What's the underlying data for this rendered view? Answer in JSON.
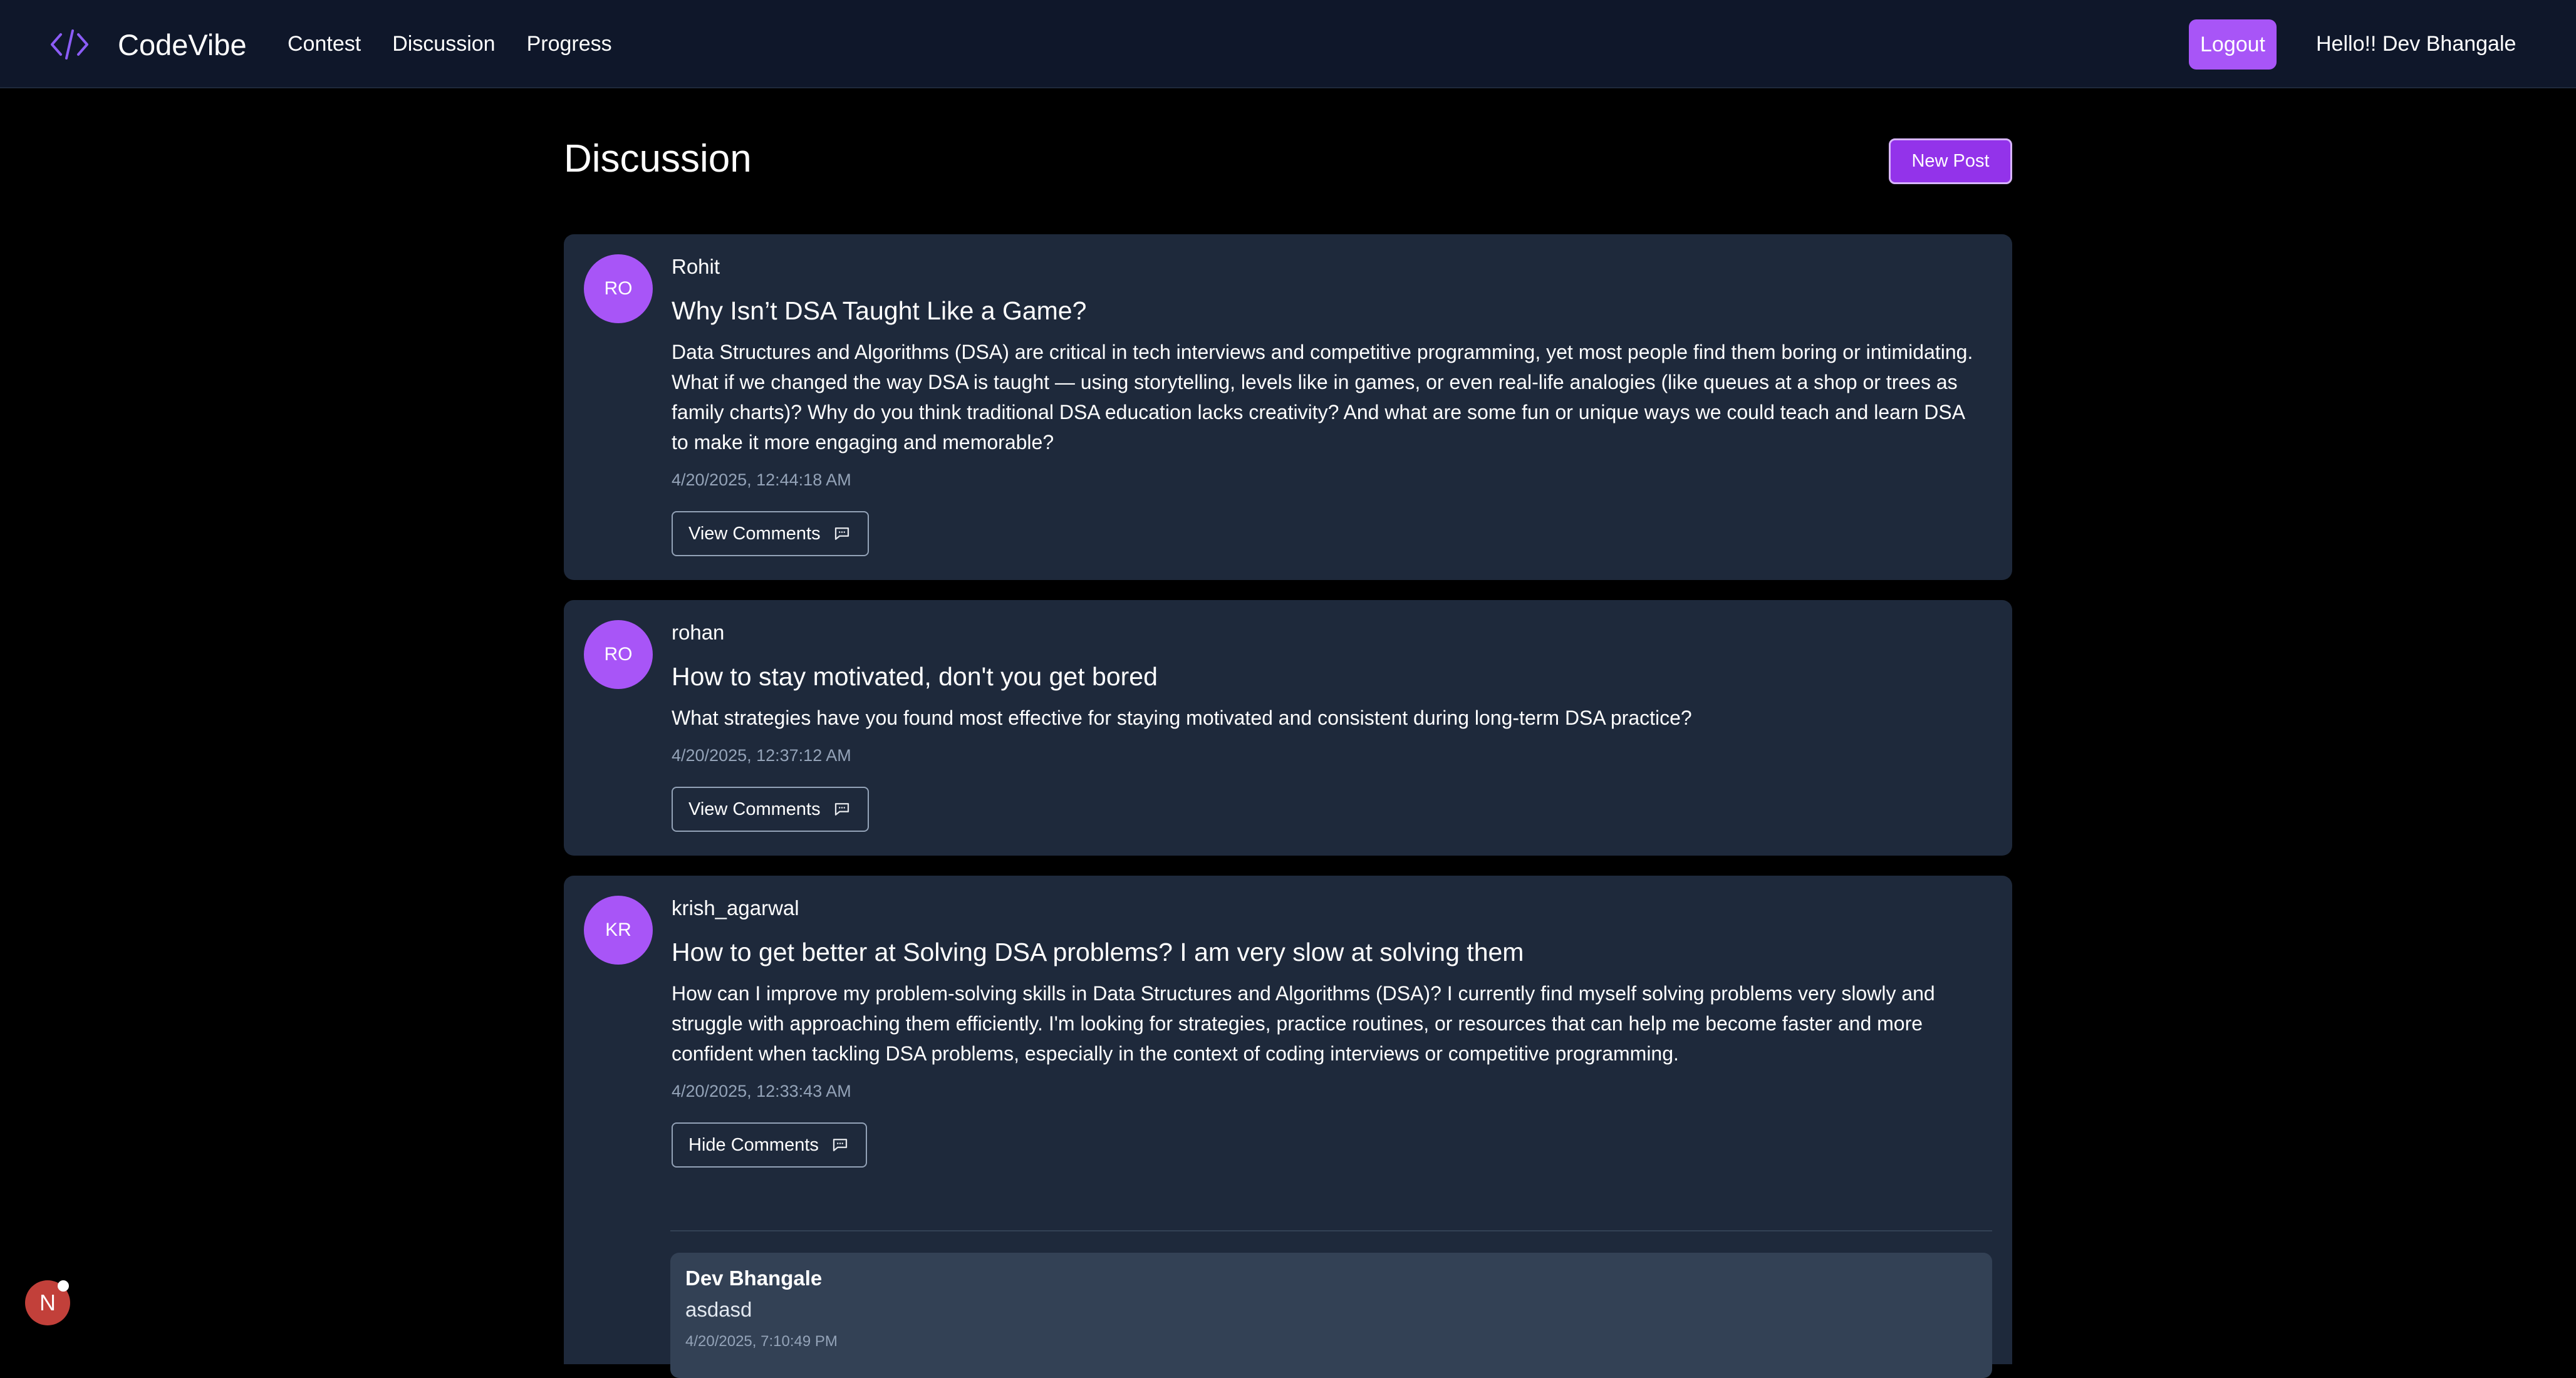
{
  "nav": {
    "brand": "CodeVibe",
    "brand_icon": "code-icon",
    "links": [
      "Contest",
      "Discussion",
      "Progress"
    ],
    "logout_label": "Logout",
    "greeting": "Hello!! Dev Bhangale"
  },
  "page": {
    "title": "Discussion",
    "new_post_label": "New Post"
  },
  "posts": [
    {
      "initials": "RO",
      "author": "Rohit",
      "title": "Why Isn’t DSA Taught Like a Game?",
      "body": "Data Structures and Algorithms (DSA) are critical in tech interviews and competitive programming, yet most people find them boring or intimidating. What if we changed the way DSA is taught — using storytelling, levels like in games, or even real-life analogies (like queues at a shop or trees as family charts)? Why do you think traditional DSA education lacks creativity? And what are some fun or unique ways we could teach and learn DSA to make it more engaging and memorable?",
      "time": "4/20/2025, 12:44:18 AM",
      "comments_label": "View Comments"
    },
    {
      "initials": "RO",
      "author": "rohan",
      "title": "How to stay motivated, don't you get bored",
      "body": "What strategies have you found most effective for staying motivated and consistent during long-term DSA practice?",
      "time": "4/20/2025, 12:37:12 AM",
      "comments_label": "View Comments"
    },
    {
      "initials": "KR",
      "author": "krish_agarwal",
      "title": "How to get better at Solving DSA problems? I am very slow at solving them",
      "body": "How can I improve my problem-solving skills in Data Structures and Algorithms (DSA)? I currently find myself solving problems very slowly and struggle with approaching them efficiently. I'm looking for strategies, practice routines, or resources that can help me become faster and more confident when tackling DSA problems, especially in the context of coding interviews or competitive programming.",
      "time": "4/20/2025, 12:33:43 AM",
      "comments_label": "Hide Comments",
      "comments": [
        {
          "author": "Dev Bhangale",
          "text": "asdasd",
          "time": "4/20/2025, 7:10:49 PM"
        }
      ]
    }
  ],
  "dev_badge": {
    "letter": "N"
  },
  "colors": {
    "accent": "#a855f7",
    "navbar_bg": "#0f172a",
    "card_bg": "#1e293b",
    "page_bg": "#000000"
  }
}
